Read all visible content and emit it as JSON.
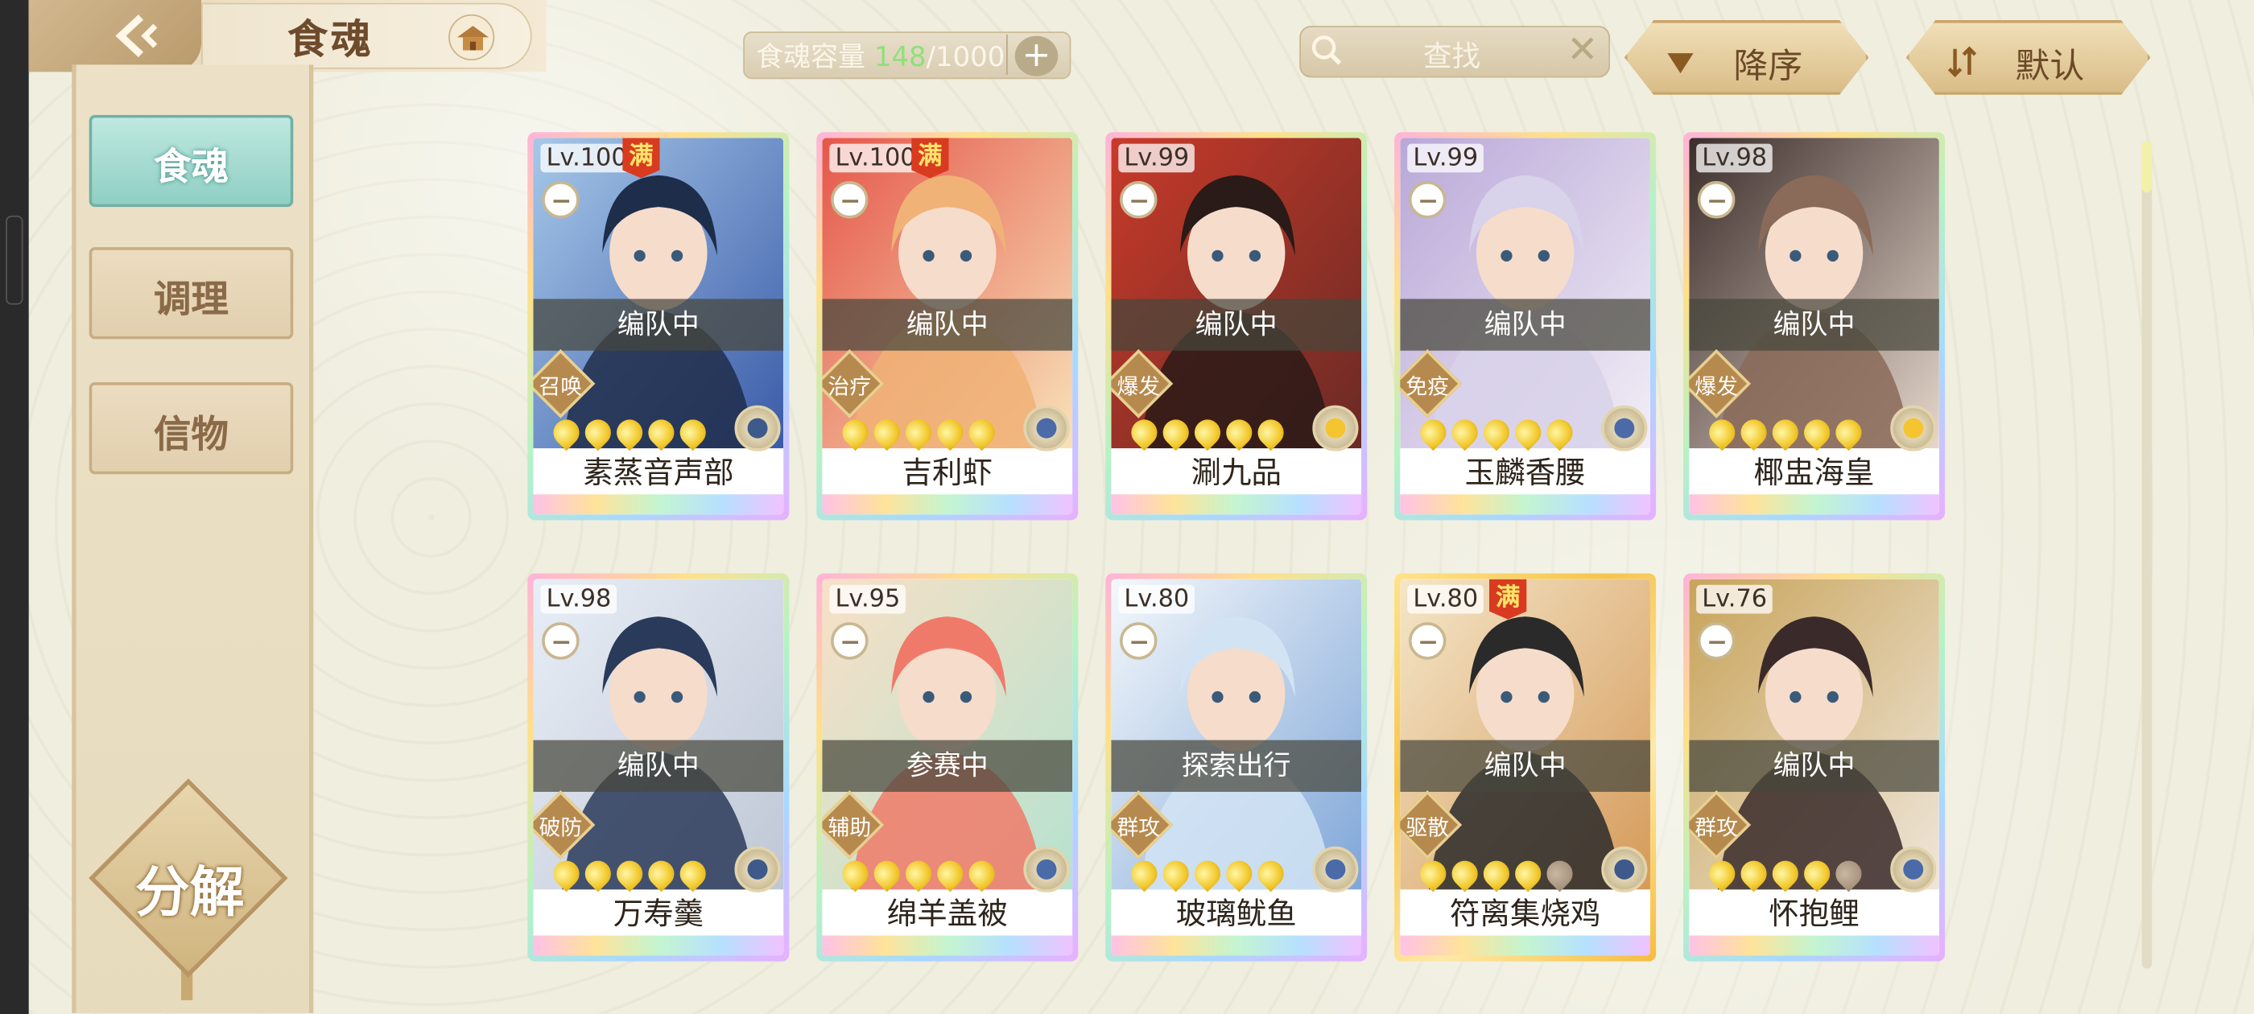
{
  "header": {
    "title": "食魂",
    "capacity_label": "食魂容量",
    "capacity_current": "148",
    "capacity_max": "/1000",
    "search_label": "查找",
    "sort_order_label": "降序",
    "sort_mode_label": "默认"
  },
  "sidebar": {
    "tabs": [
      {
        "label": "食魂"
      },
      {
        "label": "调理"
      },
      {
        "label": "信物"
      }
    ],
    "decompose_label": "分解"
  },
  "cards": [
    {
      "level": "Lv.100",
      "max": "满",
      "status": "编队中",
      "role": "召唤",
      "stars": 5,
      "element": "gear",
      "name": "素蒸音声部",
      "palette": [
        "#1e2d4a",
        "#3a5aa8",
        "#a6c8e8"
      ]
    },
    {
      "level": "Lv.100",
      "max": "满",
      "status": "编队中",
      "role": "治疗",
      "stars": 5,
      "element": "flower",
      "name": "吉利虾",
      "palette": [
        "#f0b276",
        "#f8e2b8",
        "#e5574a"
      ]
    },
    {
      "level": "Lv.99",
      "max": "",
      "status": "编队中",
      "role": "爆发",
      "stars": 5,
      "element": "blossom",
      "name": "涮九品",
      "palette": [
        "#2a1a18",
        "#6a2a24",
        "#c83a2a"
      ]
    },
    {
      "level": "Lv.99",
      "max": "",
      "status": "编队中",
      "role": "免疫",
      "stars": 5,
      "element": "flower",
      "name": "玉麟香腰",
      "palette": [
        "#d8d2ea",
        "#f2eef6",
        "#b9a8d8"
      ]
    },
    {
      "level": "Lv.98",
      "max": "",
      "status": "编队中",
      "role": "爆发",
      "stars": 5,
      "element": "blossom",
      "name": "椰盅海皇",
      "palette": [
        "#8a6a58",
        "#e6d7cc",
        "#3b2d2a"
      ]
    },
    {
      "level": "Lv.98",
      "max": "",
      "status": "编队中",
      "role": "破防",
      "stars": 5,
      "element": "gear",
      "name": "万寿羹",
      "palette": [
        "#2a3a5a",
        "#bfc7d6",
        "#e8eef6"
      ]
    },
    {
      "level": "Lv.95",
      "max": "",
      "status": "参赛中",
      "role": "辅助",
      "stars": 5,
      "element": "flower",
      "name": "绵羊盖被",
      "palette": [
        "#f07a6a",
        "#b6e2cf",
        "#f8e0c6"
      ]
    },
    {
      "level": "Lv.80",
      "max": "",
      "status": "探索出行",
      "role": "群攻",
      "stars": 5,
      "element": "flower",
      "name": "玻璃鱿鱼",
      "palette": [
        "#d2e4f4",
        "#7fa6d8",
        "#f4f8fb"
      ]
    },
    {
      "level": "Lv.80",
      "max": "满",
      "status": "编队中",
      "role": "驱散",
      "stars": 4,
      "element": "gear",
      "name": "符离集烧鸡",
      "palette": [
        "#2a2a2a",
        "#d59a5a",
        "#f4e6c8"
      ]
    },
    {
      "level": "Lv.76",
      "max": "",
      "status": "编队中",
      "role": "群攻",
      "stars": 4,
      "element": "flower",
      "name": "怀抱鲤",
      "palette": [
        "#3a2a2a",
        "#efe6da",
        "#c8a45a"
      ]
    }
  ]
}
